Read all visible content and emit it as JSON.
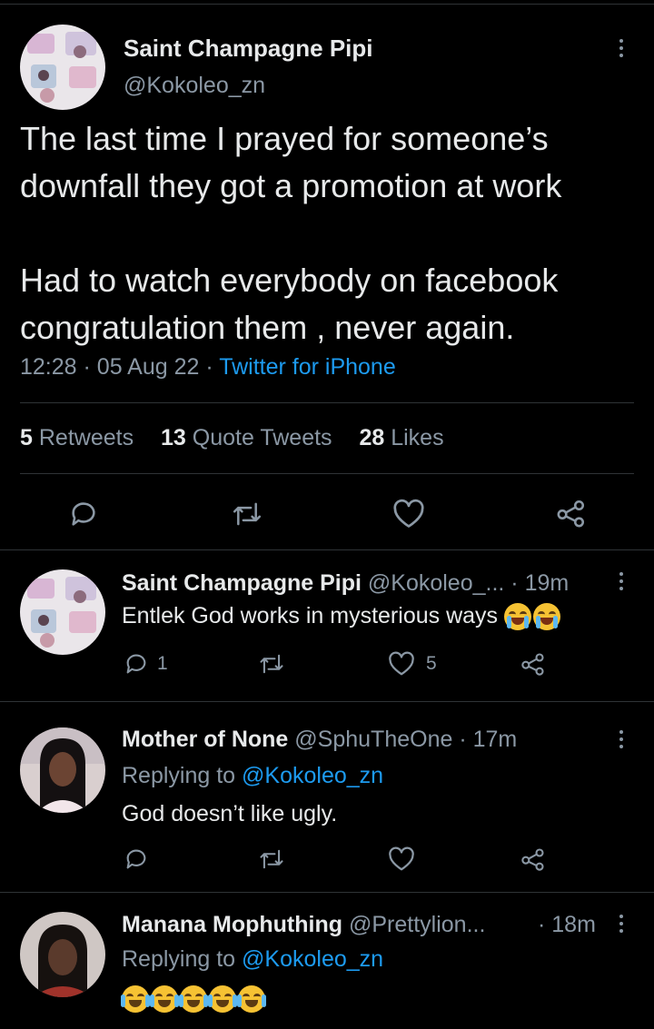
{
  "main_tweet": {
    "author_name": "Saint Champagne Pipi",
    "handle": "@Kokoleo_zn",
    "text_line1": "The last time I prayed for someone’s",
    "text_line2": "downfall they got a promotion at work",
    "text_line3": "Had to watch everybody on  facebook",
    "text_line4": "congratulation them , never again.",
    "time": "12:28",
    "sep1": "·",
    "date": "05 Aug 22",
    "sep2": "·",
    "source": "Twitter for iPhone",
    "retweets_count": "5",
    "retweets_label": "Retweets",
    "quotes_count": "13",
    "quotes_label": "Quote Tweets",
    "likes_count": "28",
    "likes_label": "Likes"
  },
  "replies": [
    {
      "author_name": "Saint Champagne Pipi",
      "handle_time": "@Kokoleo_... · 19m",
      "text": "Entlek God works in mysterious ways",
      "emoji": "loudly-crying-face x2",
      "reply_count": "1",
      "like_count": "5"
    },
    {
      "author_name": "Mother of None",
      "handle_time": "@SphuTheOne · 17m",
      "replying_prefix": "Replying to",
      "replying_handle": "@Kokoleo_zn",
      "text": "God doesn’t like ugly."
    },
    {
      "author_name": "Manana Mophuthing",
      "handle": "@Prettylion...",
      "time": "· 18m",
      "replying_prefix": "Replying to",
      "replying_handle": "@Kokoleo_zn",
      "emoji": "face-with-tears-of-joy x5"
    }
  ],
  "colors": {
    "background": "#000000",
    "text": "#e7e9ea",
    "muted": "#8b98a5",
    "link": "#1d9bf0",
    "divider": "#2f3336"
  },
  "icons": [
    "reply-icon",
    "retweet-icon",
    "like-icon",
    "share-icon",
    "more-icon"
  ]
}
